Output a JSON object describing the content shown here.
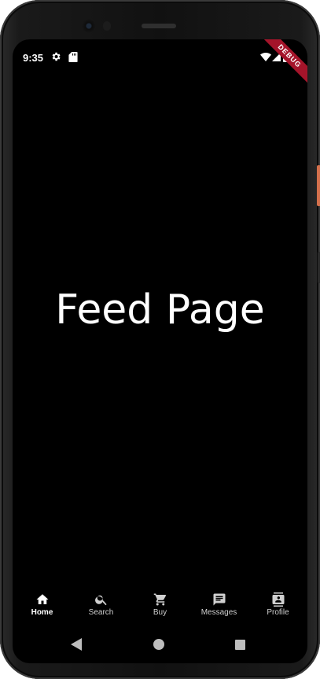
{
  "status_bar": {
    "time": "9:35",
    "icons": [
      "gear-icon",
      "sd-card-icon",
      "wifi-icon",
      "signal-icon",
      "battery-icon"
    ]
  },
  "debug_banner": {
    "label": "DEBUG"
  },
  "main": {
    "title": "Feed Page"
  },
  "bottom_nav": {
    "items": [
      {
        "label": "Home",
        "icon": "home-icon",
        "active": true
      },
      {
        "label": "Search",
        "icon": "search-icon",
        "active": false
      },
      {
        "label": "Buy",
        "icon": "cart-icon",
        "active": false
      },
      {
        "label": "Messages",
        "icon": "message-icon",
        "active": false
      },
      {
        "label": "Profile",
        "icon": "contact-icon",
        "active": false
      }
    ]
  },
  "system_nav": {
    "icons": [
      "back-icon",
      "home-circle-icon",
      "recents-icon"
    ]
  },
  "colors": {
    "screen_background": "#000000",
    "text": "#ffffff",
    "debug_banner": "#a4142a"
  }
}
